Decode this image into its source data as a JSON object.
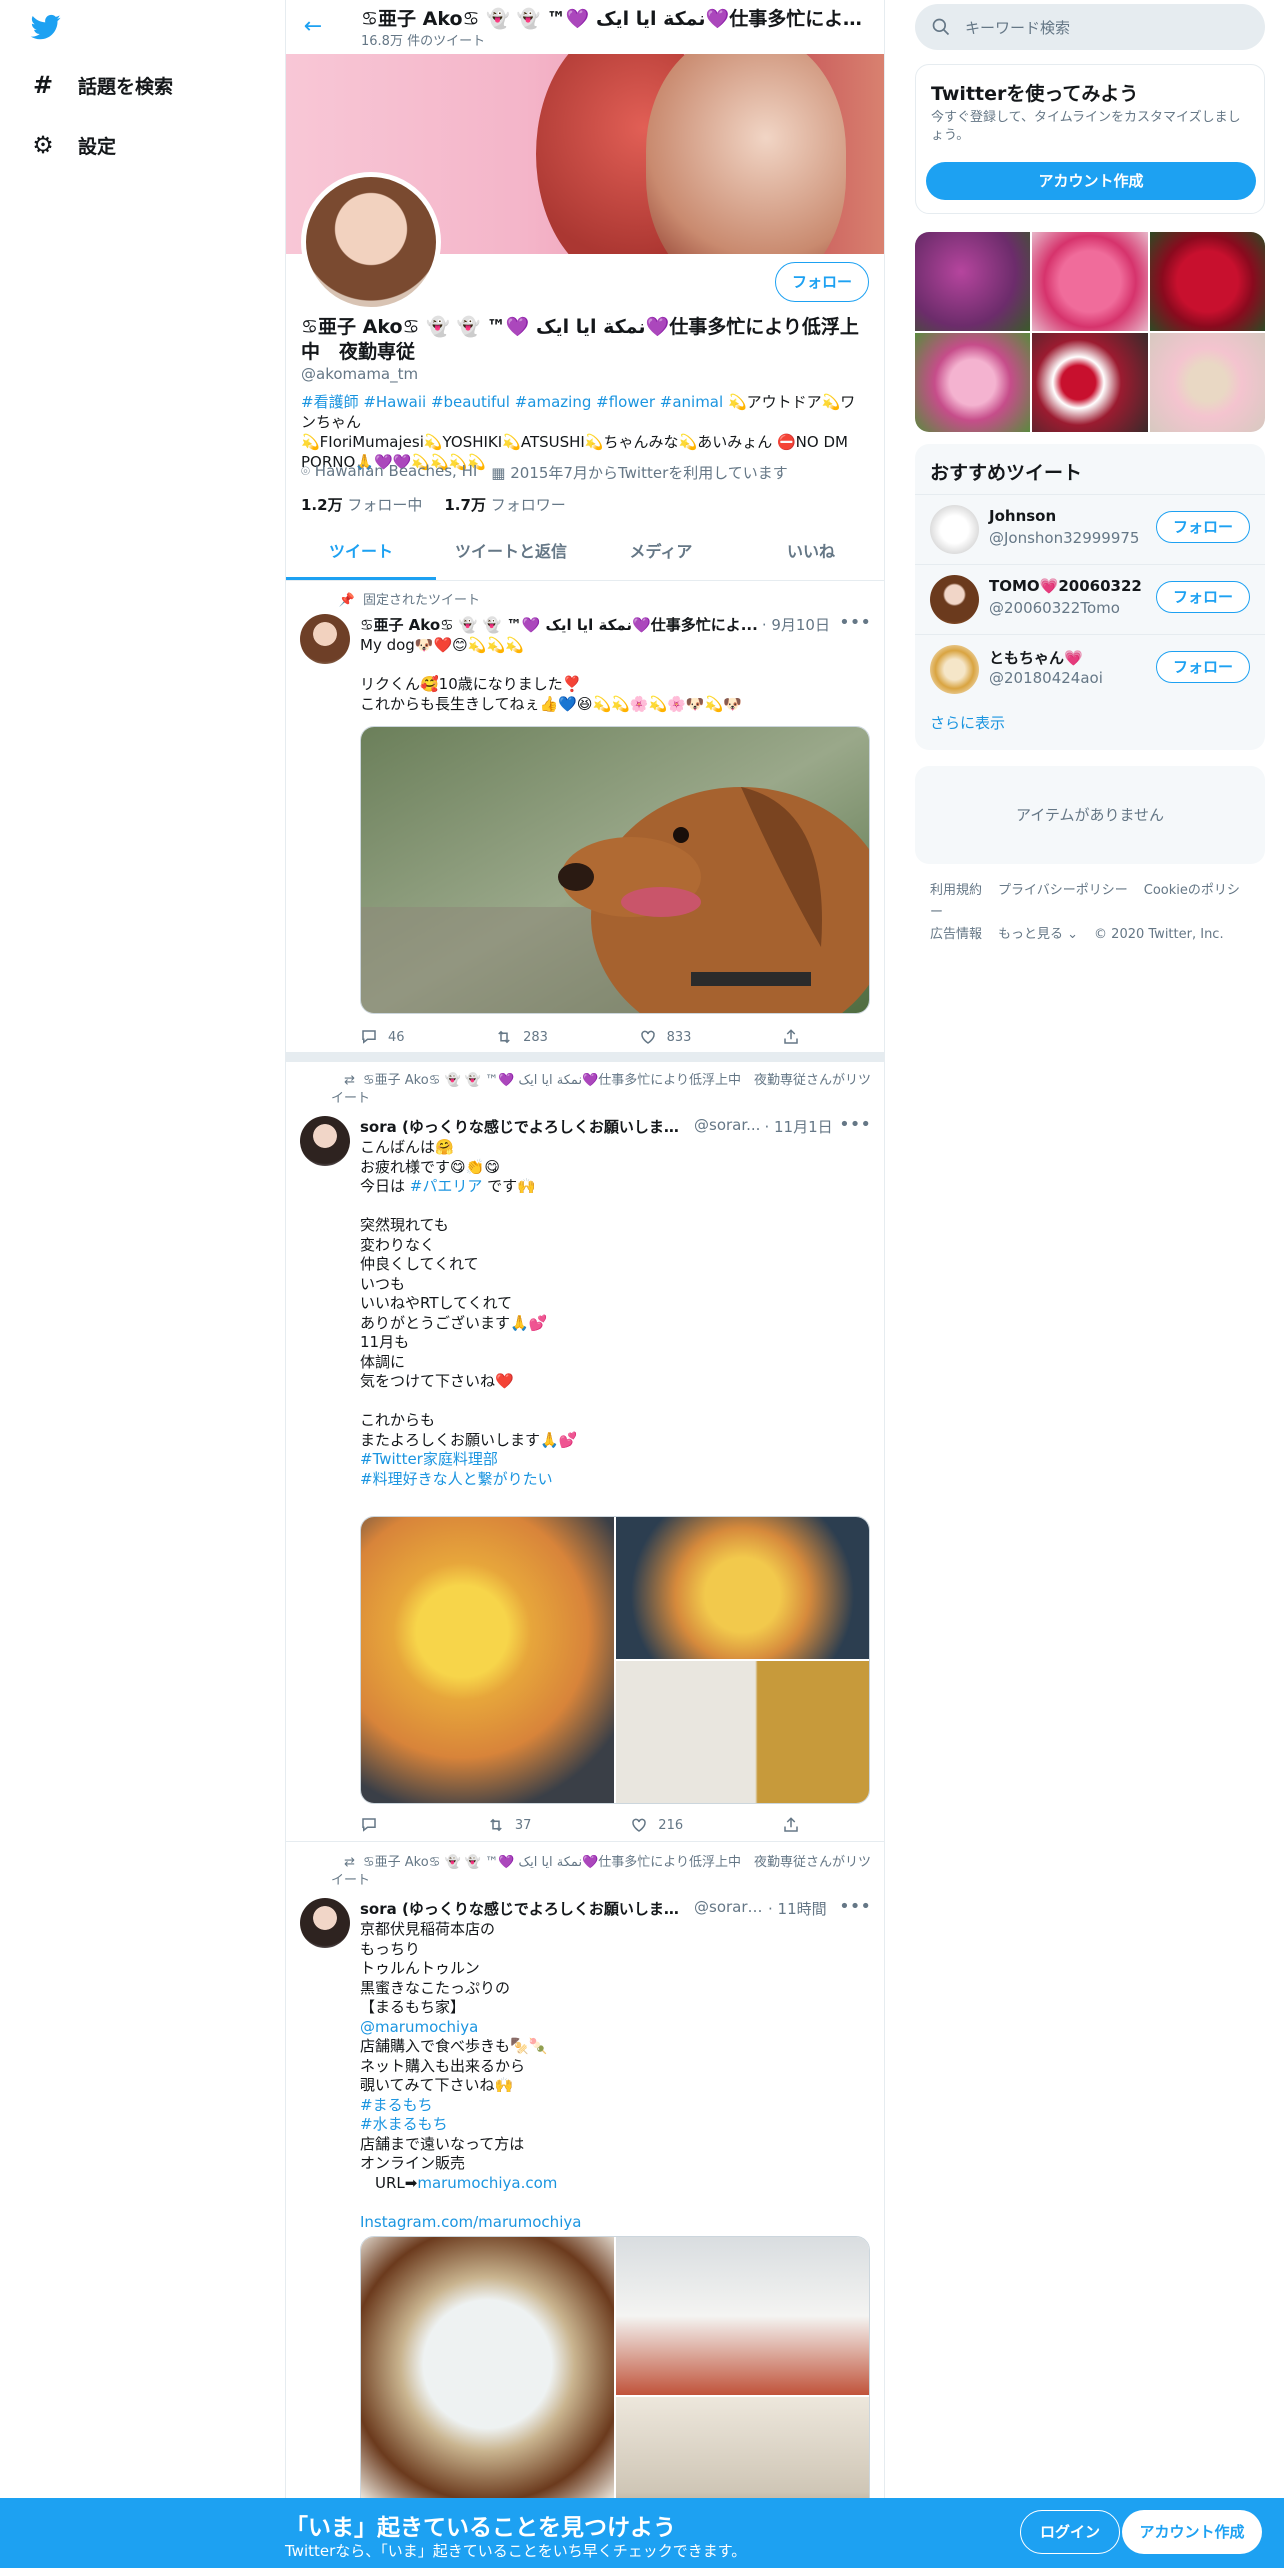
{
  "nav": {
    "explore_label": "話題を検索",
    "settings_label": "設定"
  },
  "header": {
    "name": "♋亜子 Ako♋ 👻 👻 ™💜 ﻧﻤﮑﺔ ﺍﯾﺎ ﺍﯾﮏ💜仕事多忙により低浮上中　夜勤専従",
    "tweet_count": "16.8万 件のツイート"
  },
  "profile": {
    "follow_label": "フォロー",
    "name": "♋亜子 Ako♋ 👻 👻 ™💜 ﻧﻤﮑﺔ ﺍﯾﺎ ﺍﯾﮏ💜仕事多忙により低浮上中　夜勤専従",
    "handle": "@akomama_tm",
    "bio_tags": "#看護師 #Hawaii #beautiful #amazing #flower #animal",
    "bio_text_1": " 💫アウトドア💫ワンちゃん",
    "bio_text_2": "💫FIoriMumajesi💫YOSHIKI💫ATSUSHI💫ちゃんみな💫あいみょん ⛔NO DM PORNO🙏💜💜💫💫💫💫",
    "location": "Hawaiian Beaches, HI",
    "joined": "2015年7月からTwitterを利用しています",
    "following_count": "1.2万",
    "following_label": "フォロー中",
    "followers_count": "1.7万",
    "followers_label": "フォロワー"
  },
  "tabs": [
    "ツイート",
    "ツイートと返信",
    "メディア",
    "いいね"
  ],
  "tweets": [
    {
      "context": "固定されたツイート",
      "name": "♋亜子 Ako♋ 👻 👻 ™💜 ﻧﻤﮑﺔ ﺍﯾﺎ ﺍﯾﮏ💜仕事多忙によ...",
      "handle": "",
      "date": "· 9月10日",
      "body": "My dog🐶❤️😊💫💫💫\n\nリクくん🥰10歳になりました❣️\nこれからも長生きしてねぇ👍💙😆💫💫🌸💫🌸🐶💫🐶",
      "replies": "46",
      "retweets": "283",
      "likes": "833"
    },
    {
      "context": "♋亜子 Ako♋ 👻 👻 ™💜 ﻧﻤﮑﺔ ﺍﯾﺎ ﺍﯾﮏ💜仕事多忙により低浮上中　夜勤専従さんがリツイート",
      "name": "sora (ゆっくりな感じでよろしくお願いします❤️)",
      "handle": "@sorar...",
      "date": "· 11月1日",
      "body_1": "こんばんは🤗\nお疲れ様です😋👏😋\n今日は ",
      "body_tag": "#パエリア",
      "body_2": " です🙌\n\n突然現れても\n変わりなく\n仲良くしてくれて\nいつも\nいいねやRTしてくれて\nありがとうございます🙏💕\n11月も\n体調に\n気をつけて下さいね❤️\n\nこれからも\nまたよろしくお願いします🙏💕\n",
      "tags": "#Twitter家庭料理部\n#料理好きな人と繋がりたい",
      "replies": "",
      "retweets": "37",
      "likes": "216"
    },
    {
      "context": "♋亜子 Ako♋ 👻 👻 ™💜 ﻧﻤﮑﺔ ﺍﯾﺎ ﺍﯾﮏ💜仕事多忙により低浮上中　夜勤専従さんがリツイート",
      "name": "sora (ゆっくりな感じでよろしくお願いします❤️)",
      "handle": "@sorara...",
      "date": "· 11時間",
      "body_1": "京都伏見稲荷本店の\nもっちり\nトゥルんトゥルン\n黒蜜きなこたっぷりの\n【まるもち家】\n",
      "mention": "@marumochiya",
      "body_2": "店舗購入で食べ歩きも🍢🍡\nネット購入も出来るから\n覗いてみて下さいね🙌\n",
      "tag1": "#まるもち",
      "tag2": "#水まるもち",
      "body_3": "店舗まで遠いなって方は\nオンライン販売\n　URL➡",
      "url": "marumochiya.com",
      "insta": "Instagram.com/marumochiya"
    }
  ],
  "right": {
    "search_placeholder": "キーワード検索",
    "signup_title": "Twitterを使ってみよう",
    "signup_text": "今すぐ登録して、タイムラインをカスタマイズしましょう。",
    "signup_button": "アカウント作成",
    "rec_title": "おすすめツイート",
    "rec": [
      {
        "name": "Johnson",
        "handle": "@Jonshon32999975",
        "follow": "フォロー"
      },
      {
        "name": "TOMO💗20060322",
        "handle": "@20060322Tomo",
        "follow": "フォロー"
      },
      {
        "name": "ともちゃん💗",
        "handle": "@20180424aoi",
        "follow": "フォロー"
      }
    ],
    "rec_more": "さらに表示",
    "empty_text": "アイテムがありません",
    "footer_links": [
      "利用規約",
      "プライバシーポリシー",
      "Cookieのポリシー",
      "広告情報",
      "もっと見る ⌄",
      "© 2020 Twitter, Inc."
    ]
  },
  "bottom": {
    "title": "「いま」起きていることを見つけよう",
    "subtitle": "Twitterなら、「いま」起きていることをいち早くチェックできます。",
    "login": "ログイン",
    "signup": "アカウント作成"
  },
  "colors": {
    "accent": "#1da1f2",
    "link": "#1b95e0",
    "muted": "#657786",
    "border": "#e6ecf0"
  }
}
